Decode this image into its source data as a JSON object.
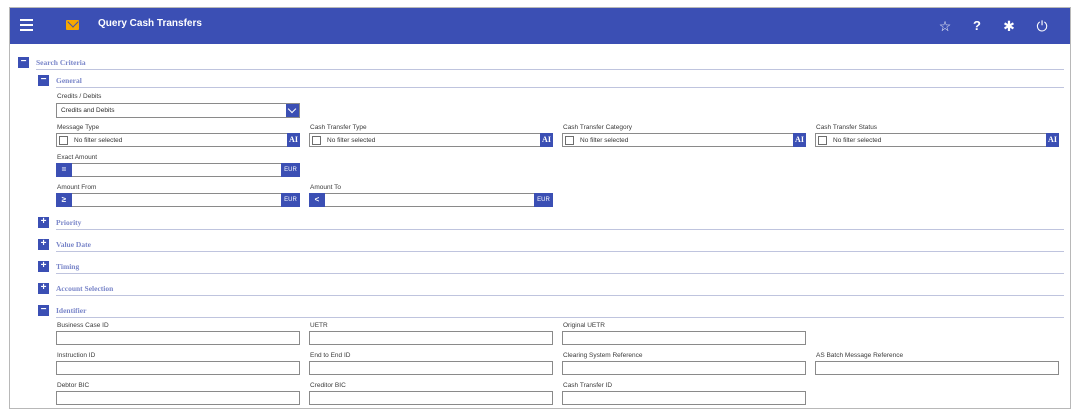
{
  "header": {
    "title": "Query Cash Transfers",
    "icons": [
      "menu-icon",
      "mail-icon",
      "star-icon",
      "help-icon",
      "gear-icon",
      "power-icon"
    ],
    "star_glyph": "☆",
    "help_glyph": "?",
    "gear_glyph": "✱",
    "power_glyph": "⏻",
    "accent": "#3b4fb4"
  },
  "toggles": {
    "collapse": "−",
    "expand": "+"
  },
  "search_criteria": {
    "label": "Search Criteria"
  },
  "general": {
    "label": "General",
    "credits_debits": {
      "label": "Credits / Debits",
      "value": "Credits and Debits"
    },
    "message_type": {
      "label": "Message Type",
      "value": "No filter selected",
      "button": "AI"
    },
    "cash_transfer_type": {
      "label": "Cash Transfer Type",
      "value": "No filter selected",
      "button": "AI"
    },
    "cash_transfer_category": {
      "label": "Cash Transfer Category",
      "value": "No filter selected",
      "button": "AI"
    },
    "cash_transfer_status": {
      "label": "Cash Transfer Status",
      "value": "No filter selected",
      "button": "AI"
    },
    "exact_amount": {
      "label": "Exact Amount",
      "operator": "=",
      "currency": "EUR"
    },
    "amount_from": {
      "label": "Amount From",
      "operator": "≥",
      "currency": "EUR"
    },
    "amount_to": {
      "label": "Amount To",
      "operator": "<",
      "currency": "EUR"
    }
  },
  "collapsed_sections": {
    "priority": "Priority",
    "value_date": "Value Date",
    "timing": "Timing",
    "account_selection": "Account Selection"
  },
  "identifier": {
    "label": "Identifier",
    "business_case_id": "Business Case ID",
    "uetr": "UETR",
    "original_uetr": "Original UETR",
    "instruction_id": "Instruction ID",
    "end_to_end_id": "End to End ID",
    "clearing_system_reference": "Clearing System Reference",
    "as_batch_message_reference": "AS Batch Message Reference",
    "debtor_bic": "Debtor BIC",
    "creditor_bic": "Creditor BIC",
    "cash_transfer_id": "Cash Transfer ID"
  }
}
